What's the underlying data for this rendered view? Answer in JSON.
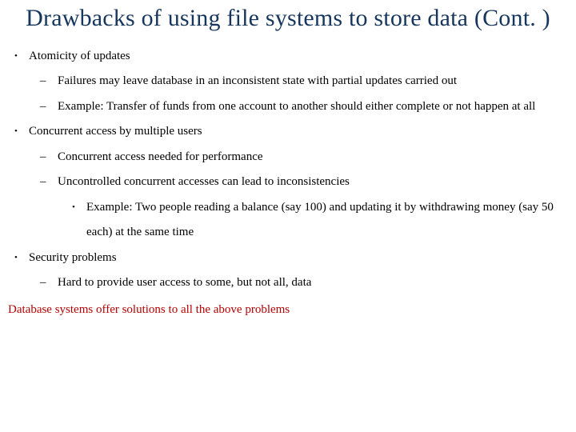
{
  "title": "Drawbacks of using file systems to store data (Cont. )",
  "b1": {
    "heading": "Atomicity of updates",
    "s1": "Failures may leave database in an inconsistent state with partial updates carried out",
    "s2": "Example: Transfer of funds from one account to another should either complete or not happen at all"
  },
  "b2": {
    "heading": "Concurrent access by multiple users",
    "s1": "Concurrent access needed for performance",
    "s2": "Uncontrolled concurrent accesses can lead to inconsistencies",
    "s2a": "Example: Two people reading a balance (say 100) and updating it by withdrawing money (say 50 each) at the same time"
  },
  "b3": {
    "heading": "Security problems",
    "s1": "Hard to provide user access to some, but not all, data"
  },
  "conclusion": "Database systems offer solutions to all the above problems"
}
